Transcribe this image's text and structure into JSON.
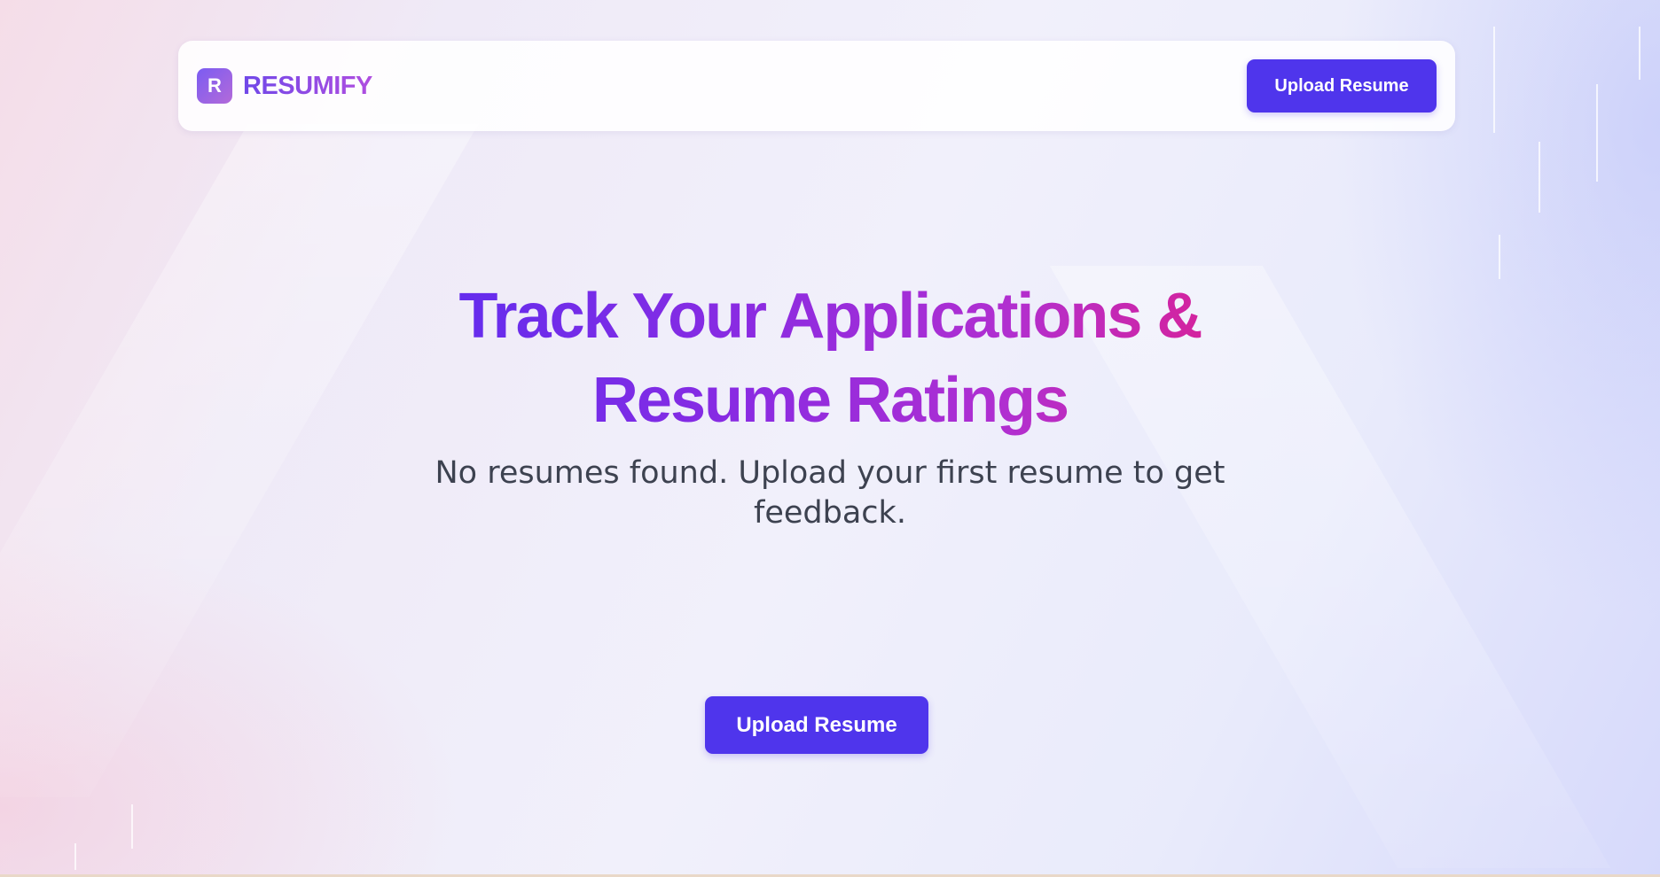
{
  "brand": {
    "logo_letter": "R",
    "name": "RESUMIFY"
  },
  "navbar": {
    "upload_label": "Upload Resume"
  },
  "hero": {
    "title": "Track Your Applications & Resume Ratings",
    "subtitle": "No resumes found. Upload your first resume to get feedback.",
    "upload_label": "Upload Resume"
  },
  "colors": {
    "primary_button": "#4f35ec",
    "title_gradient_start": "#5b2df0",
    "title_gradient_end": "#e01f8c",
    "body_text": "#3d4250"
  }
}
